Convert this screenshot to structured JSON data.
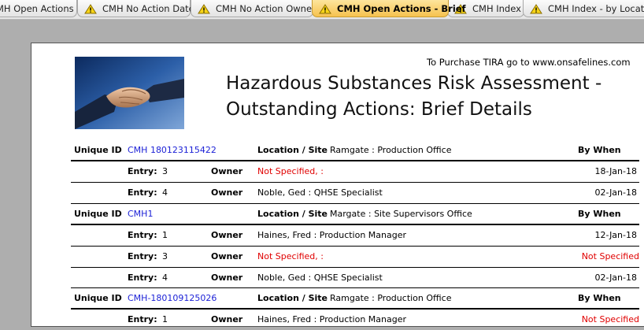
{
  "tabs": [
    {
      "label": "MH Open Actions",
      "warning": false,
      "active": false
    },
    {
      "label": "CMH No Action Date",
      "warning": true,
      "active": false
    },
    {
      "label": "CMH No Action Owner",
      "warning": true,
      "active": false
    },
    {
      "label": "CMH Open Actions - Brief",
      "warning": true,
      "active": true
    },
    {
      "label": "CMH Index",
      "warning": true,
      "active": false
    },
    {
      "label": "CMH Index - by Location",
      "warning": true,
      "active": false
    }
  ],
  "report": {
    "purchase_note": "To Purchase TIRA go to www.onsafelines.com",
    "title_line1": "Hazardous Substances Risk Assessment -",
    "title_line2": "Outstanding Actions: Brief Details",
    "labels": {
      "unique_id": "Unique ID",
      "location": "Location / Site",
      "by_when": "By When",
      "entry": "Entry:",
      "owner": "Owner"
    },
    "groups": [
      {
        "unique_id": "CMH 180123115422",
        "location": "Ramgate : Production Office",
        "entries": [
          {
            "entry": "3",
            "owner": "Not Specified,  :",
            "owner_missing": true,
            "by_when": "18-Jan-18",
            "date_missing": false
          },
          {
            "entry": "4",
            "owner": "Noble, Ged : QHSE Specialist",
            "owner_missing": false,
            "by_when": "02-Jan-18",
            "date_missing": false
          }
        ]
      },
      {
        "unique_id": "CMH1",
        "location": "Margate : Site Supervisors Office",
        "entries": [
          {
            "entry": "1",
            "owner": "Haines, Fred : Production Manager",
            "owner_missing": false,
            "by_when": "12-Jan-18",
            "date_missing": false
          },
          {
            "entry": "3",
            "owner": "Not Specified,  :",
            "owner_missing": true,
            "by_when": "Not Specified",
            "date_missing": true
          },
          {
            "entry": "4",
            "owner": "Noble, Ged : QHSE Specialist",
            "owner_missing": false,
            "by_when": "02-Jan-18",
            "date_missing": false
          }
        ]
      },
      {
        "unique_id": "CMH-180109125026",
        "location": "Ramgate : Production Office",
        "entries": [
          {
            "entry": "1",
            "owner": "Haines, Fred : Production Manager",
            "owner_missing": false,
            "by_when": "Not Specified",
            "date_missing": true
          }
        ]
      }
    ]
  },
  "colors": {
    "id_blue": "#1a1fd6",
    "missing_red": "#e00000",
    "active_tab": "#f6c24f"
  },
  "icons": {
    "tab_warning": "warning-triangle-icon",
    "header_image": "handshake-photo"
  }
}
